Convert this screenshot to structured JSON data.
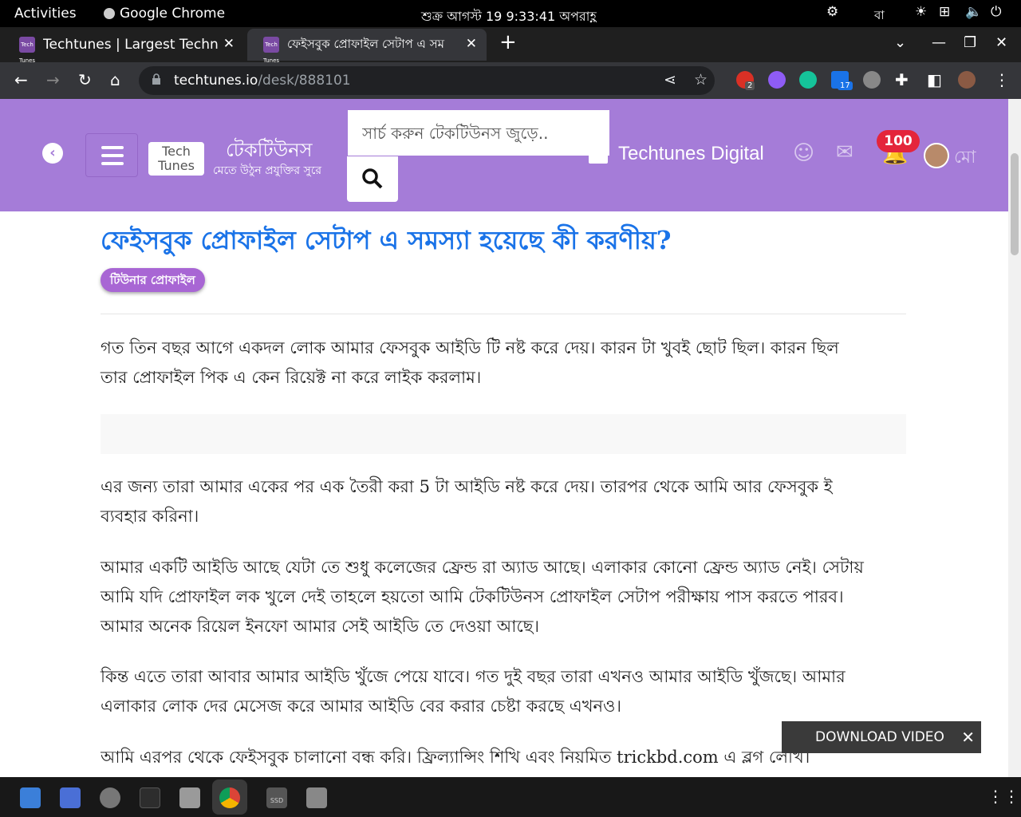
{
  "system": {
    "activities": "Activities",
    "app": "Google Chrome",
    "clock": "শুক্র আগস্ট 19  9:33:41 অপরাহ্ণ",
    "lang": "বা"
  },
  "tabs": [
    {
      "label": "Techtunes | Largest Techn",
      "favicon": "Tech Tunes"
    },
    {
      "label": "ফেইসবুক প্রোফাইল সেটাপ এ সম",
      "favicon": "Tech Tunes"
    }
  ],
  "omnibox": {
    "host": "techtunes.io",
    "path": "/desk/888101"
  },
  "extensions": {
    "badge1": "2",
    "badge2": "17"
  },
  "header": {
    "logo": "Tech Tunes",
    "brand": "টেকটিউনস",
    "tagline": "মেতে উঠুন প্রযুক্তির সুরে",
    "search_placeholder": "সার্চ করুন টেকটিউনস জুড়ে..",
    "digital": "Techtunes Digital",
    "notif_count": "100",
    "user_short": "মো"
  },
  "article": {
    "title": "ফেইসবুক প্রোফাইল সেটাপ এ সমস্যা হয়েছে কী করণীয়?",
    "tag": "টিউনার প্রোফাইল",
    "p1_l1": "গত তিন বছর আগে একদল লোক আমার ফেসবুক আইডি টি নষ্ট করে দেয়। কারন টা খুবই ছোট ছিল। কারন ছিল",
    "p1_l2": "তার প্রোফাইল পিক এ কেন রিয়েক্ট না করে লাইক করলাম।",
    "p2_l1": "এর জন্য তারা আমার একের পর এক তৈরী করা 5 টা আইডি নষ্ট করে দেয়। তারপর থেকে আমি আর ফেসবুক ই",
    "p2_l2": "ব্যবহার করিনা।",
    "p3_l1": "আমার একটি আইডি আছে যেটা তে শুধু কলেজের ফ্রেন্ড রা অ্যাড আছে। এলাকার কোনো ফ্রেন্ড অ্যাড নেই। সেটায়",
    "p3_l2": "আমি যদি প্রোফাইল লক খুলে দেই তাহলে হয়তো আমি টেকটিউনস প্রোফাইল সেটাপ পরীক্ষায় পাস করতে পারব।",
    "p3_l3": "আমার অনেক রিয়েল ইনফো আমার সেই আইডি তে দেওয়া আছে।",
    "p4_l1": "কিন্ত এতে তারা আবার আমার আইডি খুঁজে পেয়ে যাবে। গত দুই বছর তারা এখনও আমার আইডি খুঁজছে। আমার",
    "p4_l2": "এলাকার লোক দের মেসেজ করে আমার আইডি বের করার চেষ্টা করছে এখনও।",
    "p5_l1": "আমি এরপর থেকে ফেইসবুক চালানো বন্ধ করি। ফ্রিল্যান্সিং শিখি এবং নিয়মিত trickbd.com এ ব্লগ লেখি।"
  },
  "download": {
    "label": "DOWNLOAD VIDEO",
    "close": "✕"
  },
  "dock": {
    "ssd": "SSD"
  }
}
